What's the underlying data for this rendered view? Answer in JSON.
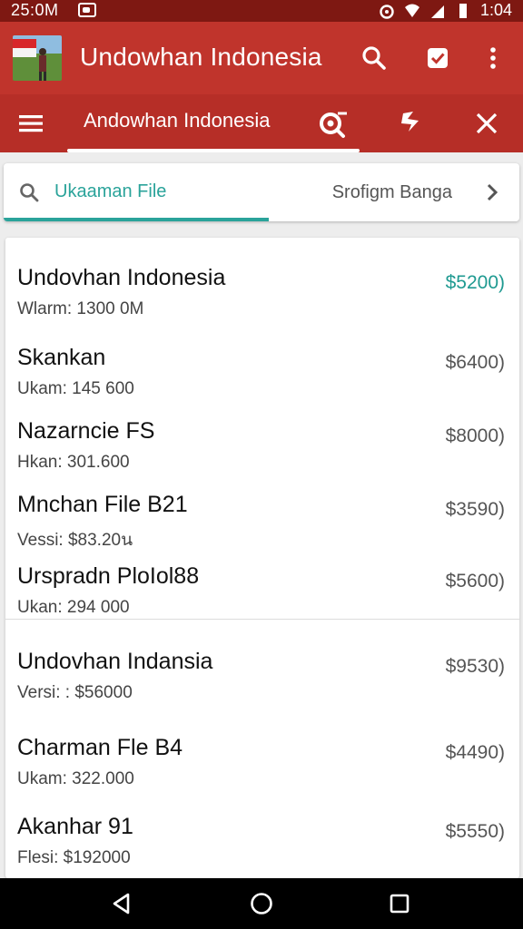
{
  "status_bar": {
    "time_left": "25:0M",
    "time_right": "1:04",
    "icons": [
      "notification-icon",
      "alarm-icon",
      "wifi-icon",
      "signal-icon",
      "battery-icon"
    ]
  },
  "toolbar": {
    "title": "Undowhan Indonesia",
    "actions": [
      "search-icon",
      "checkbox-icon",
      "more-vert-icon"
    ]
  },
  "tabbar": {
    "title": "Andowhan Indonesia",
    "actions": [
      "search-zoom-icon",
      "wand-icon",
      "close-icon"
    ]
  },
  "search": {
    "label": "Ukaaman File",
    "right_text": "Srofigm Banga"
  },
  "colors": {
    "status_bar": "#7e1812",
    "toolbar": "#c0342c",
    "tabbar": "#b62e27",
    "accent": "#2aa39a"
  },
  "items": [
    {
      "name": "Undovhan Indonesia",
      "sub": "Wlarm: 1300 0M",
      "price": "$5200)"
    },
    {
      "name": "Skankan",
      "sub": "Ukam: 145 600",
      "price": "$6400)"
    },
    {
      "name": "Nazarncie FS",
      "sub": "Hkan: 301.600",
      "price": "$8000)"
    },
    {
      "name": "Mnchan File B21",
      "sub": "Vessi: $83.20น",
      "price": "$3590)"
    },
    {
      "name": "Urspradn PloIol88",
      "sub": "Ukan: 294 000",
      "price": "$5600)"
    },
    {
      "name": "Undovhan Indansia",
      "sub": "Versi: : $56000",
      "price": "$9530)"
    },
    {
      "name": "Charman Fle B4",
      "sub": "Ukam: 322.000",
      "price": "$4490)"
    },
    {
      "name": "Akanhar 91",
      "sub": "Flesi: $192000",
      "price": "$5550)"
    }
  ],
  "navbar": [
    "back-icon",
    "home-icon",
    "recents-icon"
  ]
}
